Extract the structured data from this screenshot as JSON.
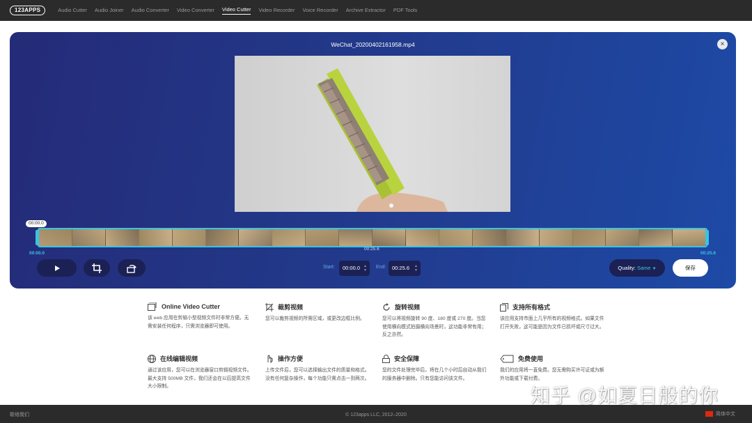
{
  "nav": {
    "logo": "123APPS",
    "items": [
      "Audio Cutter",
      "Audio Joiner",
      "Audio Converter",
      "Video Converter",
      "Video Cutter",
      "Video Recorder",
      "Voice Recorder",
      "Archive Extractor",
      "PDF Tools"
    ],
    "active": "Video Cutter"
  },
  "editor": {
    "file_name": "WeChat_20200402161958.mp4",
    "close_symbol": "×",
    "playhead_time": "00:00.0",
    "timeline_start": "00:00.0",
    "timeline_mid": "00:25.6",
    "timeline_end": "00:25.6",
    "start_label": "Start:",
    "start_value": "00:00.0",
    "end_label": "End:",
    "end_value": "00:25.6",
    "quality_label": "Quality:",
    "quality_value": "Same",
    "save_label": "保存",
    "accent": "#39c4e4"
  },
  "features": [
    {
      "title": "Online Video Cutter",
      "icon": "video-cutter-icon",
      "desc": "该 web 应用在剪辑小型视频文件时非常方便。无需安装任何程序，只需浏览器即可使用。"
    },
    {
      "title": "裁剪视频",
      "icon": "crop-icon",
      "desc": "您可以裁剪视频的所需区域，或更改边框比例。"
    },
    {
      "title": "旋转视频",
      "icon": "rotate-icon",
      "desc": "您可以将视频旋转 90 度、180 度或 270 度。当您使用横向模式拍摄横向场景时，这功能非常有用；反之亦然。"
    },
    {
      "title": "支持所有格式",
      "icon": "formats-icon",
      "desc": "该应用支持市面上几乎所有的视频格式。如果文件打开失败，这可能是因为文件已损坏或尺寸过大。"
    },
    {
      "title": "在线编辑视频",
      "icon": "globe-icon",
      "desc": "通过该应用，您可以在浏览器窗口剪辑视频文件。最大支持 500MB 文件，我们还会在以后提高文件大小限制。"
    },
    {
      "title": "操作方便",
      "icon": "hand-icon",
      "desc": "上传文件后，您可以选择输出文件的质量和格式。没有任何复杂操作，每个功能只需点击一到两次。"
    },
    {
      "title": "安全保障",
      "icon": "lock-icon",
      "desc": "您的文件处理完毕后，将在几个小时后自动从我们的服务器中删除。只有您能访问该文件。"
    },
    {
      "title": "免费使用",
      "icon": "free-icon",
      "desc": "我们的应用将一直免费。您无需购买许可证或为额外功能或下载付费。"
    }
  ],
  "watermark": "知乎 @如夏日般的你",
  "footer": {
    "contact": "联络我们",
    "copyright": "© 123apps LLC, 2012–2020",
    "language": "简体中文"
  }
}
